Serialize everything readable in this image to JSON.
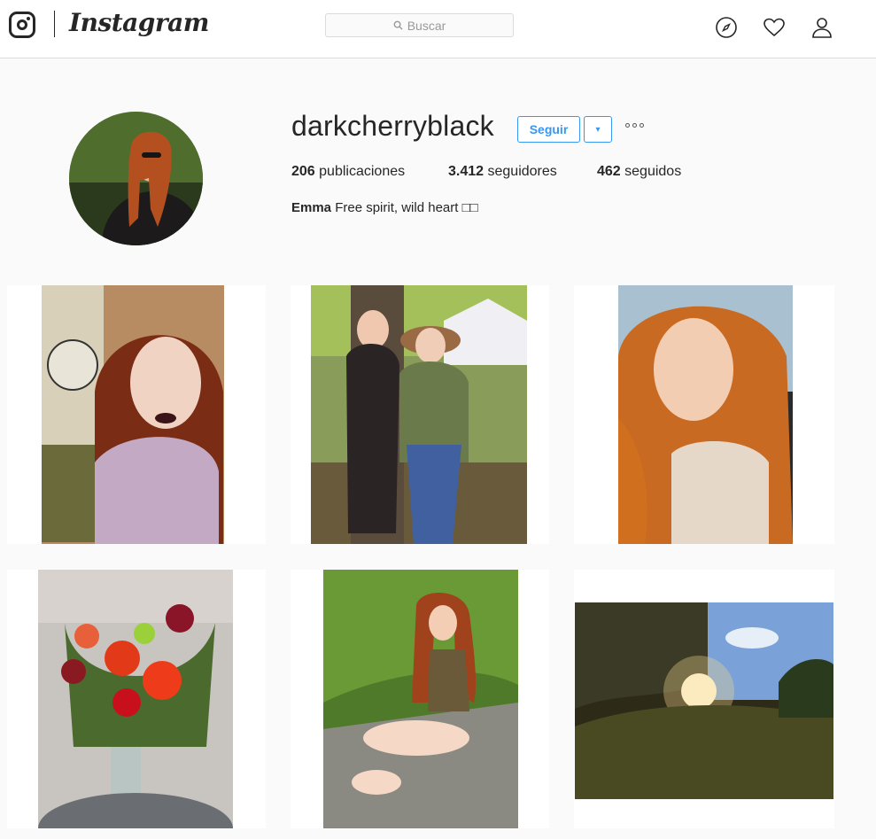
{
  "header": {
    "wordmark": "Instagram",
    "search_placeholder": "Buscar",
    "icons": [
      "explore-compass-icon",
      "activity-heart-icon",
      "profile-person-icon"
    ]
  },
  "profile": {
    "username": "darkcherryblack",
    "follow_label": "Seguir",
    "dropdown_glyph": "▾",
    "posts_count": "206",
    "posts_label": "publicaciones",
    "followers_count": "3.412",
    "followers_label": "seguidores",
    "following_count": "462",
    "following_label": "seguidos",
    "full_name": "Emma",
    "bio_text": "Free spirit, wild heart □□"
  },
  "colors": {
    "accent": "#3897f0",
    "text": "#262626",
    "border": "#dbdbdb",
    "background": "#fafafa"
  },
  "posts": [
    {
      "name": "post-1"
    },
    {
      "name": "post-2"
    },
    {
      "name": "post-3"
    },
    {
      "name": "post-4"
    },
    {
      "name": "post-5"
    },
    {
      "name": "post-6"
    }
  ]
}
